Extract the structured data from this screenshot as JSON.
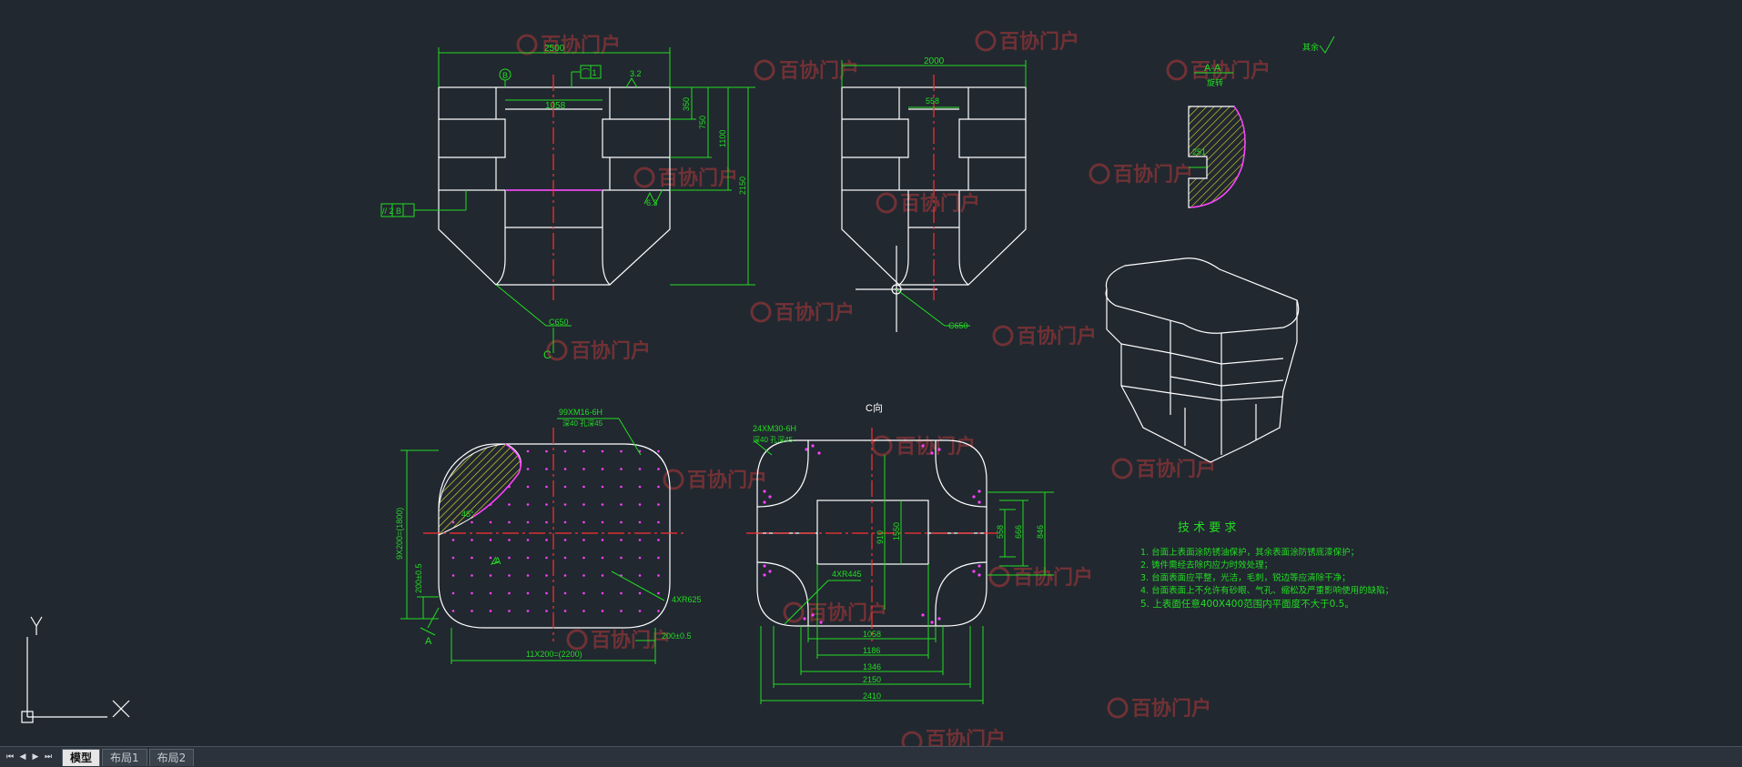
{
  "layout_tabs": [
    {
      "label": "模型",
      "active": true
    },
    {
      "label": "布局1",
      "active": false
    },
    {
      "label": "布局2",
      "active": false
    }
  ],
  "nav_buttons": [
    "⏮",
    "◀",
    "▶",
    "⏭"
  ],
  "watermark": "百协门户",
  "drawing": {
    "front": {
      "width_dim": "2500",
      "inner_dim": "1058",
      "v_dims": [
        "350",
        "750",
        "1100",
        "2150"
      ],
      "datum": "B",
      "flatness": "⌒ 1",
      "parallelism": "// 2 B",
      "rough_a": "3.2",
      "rough_b": "6.3",
      "chamfer": "C650",
      "section_label": "C"
    },
    "side": {
      "width_dim": "2000",
      "inner_dim": "558",
      "chamfer": "C650"
    },
    "section": {
      "title": "A-A",
      "sub": "旋转",
      "dim": "251"
    },
    "rough_other": "其余",
    "top": {
      "holes": "99XM16-6H",
      "holes_sub": "深40 孔深45",
      "v_dim1": "9X200=(1800)",
      "v_dim2": "200±0.5",
      "h_dim1": "11X200=(2200)",
      "h_dim2": "200±0.5",
      "radius": "4XR625",
      "angle": "45°",
      "view_label": "A"
    },
    "bottom": {
      "title": "C向",
      "holes": "24XM30-6H",
      "holes_sub": "深40 孔深45",
      "radius": "4XR445",
      "v_dims": [
        "910",
        "1550"
      ],
      "right_dims": [
        "558",
        "666",
        "846"
      ],
      "h_dims": [
        "1058",
        "1186",
        "1346",
        "2150",
        "2410"
      ]
    }
  },
  "tech_req": {
    "title": "技 术 要 求",
    "items": [
      "1. 台面上表面涂防锈油保护，其余表面涂防锈底漆保护；",
      "2. 铸件需经去除内应力时效处理；",
      "3. 台面表面应平整，光洁，毛刺，锐边等应清除干净；",
      "4. 台面表面上不允许有砂眼、气孔、缩松及严重影响使用的缺陷；",
      "5. 上表面任意400X400范围内平面度不大于0.5。"
    ]
  }
}
